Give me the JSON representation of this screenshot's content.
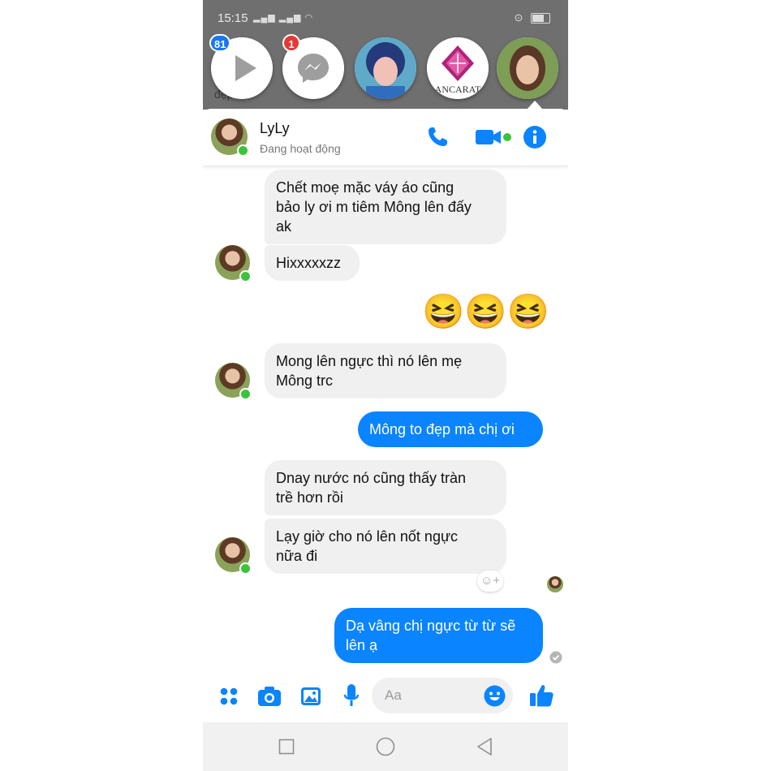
{
  "status_bar": {
    "time": "15:15"
  },
  "background_snippet": "đẹp",
  "chat_heads": [
    {
      "name": "video-app",
      "badge": "81",
      "badge_color": "#1877f2"
    },
    {
      "name": "messenger",
      "badge": "1",
      "badge_color": "#e53935"
    },
    {
      "name": "contact-photo-1"
    },
    {
      "name": "ancarat",
      "label": "ANCARAT"
    },
    {
      "name": "lyly-active"
    }
  ],
  "conversation": {
    "contact_name": "LyLy",
    "contact_status": "Đang hoạt động"
  },
  "messages": [
    {
      "from": "them",
      "text_lines": [
        "Chết moẹ mặc váy áo cũng",
        "bảo ly ơi m tiêm Mông lên đấy",
        "ak"
      ]
    },
    {
      "from": "them",
      "text": "Hixxxxxzz"
    },
    {
      "from": "me",
      "type": "emoji",
      "emoji": "😆😆😆"
    },
    {
      "from": "them",
      "text_lines": [
        "Mong lên ngực thì nó lên mẹ",
        "Mông trc"
      ]
    },
    {
      "from": "me",
      "text": "Mông to đẹp mà chị ơi"
    },
    {
      "from": "them",
      "text_lines": [
        "Dnay nước nó cũng thấy tràn",
        "trề hơn rồi"
      ]
    },
    {
      "from": "them",
      "text_lines": [
        "Lạy giờ cho nó lên nốt ngực",
        "nữa đi"
      ]
    },
    {
      "from": "me",
      "text_lines": [
        "Dạ vâng chị ngực từ từ sẽ",
        "lên ạ"
      ]
    }
  ],
  "composer": {
    "placeholder": "Aa"
  },
  "colors": {
    "accent": "#0a84ff",
    "online": "#3ac43a",
    "incoming_bubble": "#f0f0f0"
  },
  "icons": [
    "phone-icon",
    "video-camera-icon",
    "info-icon",
    "apps-grid-icon",
    "camera-icon",
    "photo-gallery-icon",
    "microphone-icon",
    "emoji-icon",
    "thumbs-up-icon",
    "nav-recent-icon",
    "nav-home-icon",
    "nav-back-icon",
    "add-reaction-icon",
    "sent-check-icon"
  ]
}
